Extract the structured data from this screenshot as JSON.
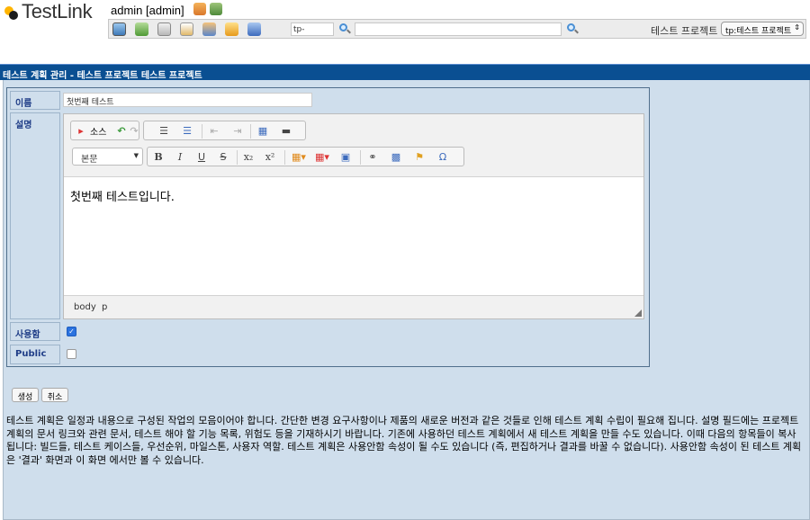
{
  "header": {
    "logo_text": "TestLink",
    "user": "admin [admin]",
    "testplan_search_value": "tp-",
    "project_label": "테스트 프로젝트",
    "project_selected": "tp:테스트 프로젝트",
    "icons": [
      "user-icon",
      "logout-icon",
      "desktop-icon",
      "tree-icon",
      "test-spec-icon",
      "document-icon",
      "users-icon",
      "bug-icon",
      "feather-icon",
      "search-icon"
    ]
  },
  "page": {
    "title": "테스트 계획 관리 - 테스트 프로젝트 테스트 프로젝트"
  },
  "form": {
    "name_label": "이름",
    "name_value": "첫번째 테스트",
    "description_label": "설명",
    "active_label": "사용함",
    "active_checked": true,
    "public_label": "Public",
    "public_checked": false,
    "create_button": "생성",
    "cancel_button": "취소"
  },
  "editor": {
    "source_label": "소스",
    "format_selected": "본문",
    "content": "첫번째 테스트입니다.",
    "path": [
      "body",
      "p"
    ]
  },
  "help_text": "테스트 계획은 일정과 내용으로 구성된 작업의 모음이어야 합니다. 간단한 변경 요구사항이나 제품의 새로운 버전과 같은 것들로 인해 테스트 계획 수립이 필요해 집니다. 설명 필드에는 프로젝트 계획의 문서 링크와 관련 문서, 테스트 해야 할 기능 목록, 위험도 등을 기재하시기 바랍니다. 기존에 사용하던 테스트 계획에서 새 테스트 계획을 만들 수도 있습니다. 이때 다음의 항목들이 복사 됩니다: 빌드들, 테스트 케이스들, 우선순위, 마일스톤, 사용자 역할. 테스트 계획은 사용안함 속성이 될 수도 있습니다 (즉, 편집하거나 결과를 바꿀 수 없습니다). 사용안함 속성이 된 테스트 계획은 '결과' 화면과 이 화면 에서만 볼 수 있습니다.",
  "colors": {
    "title_bar": "#0a4f92",
    "panel_bg": "#cfdeec",
    "label_text": "#1f3d87"
  }
}
